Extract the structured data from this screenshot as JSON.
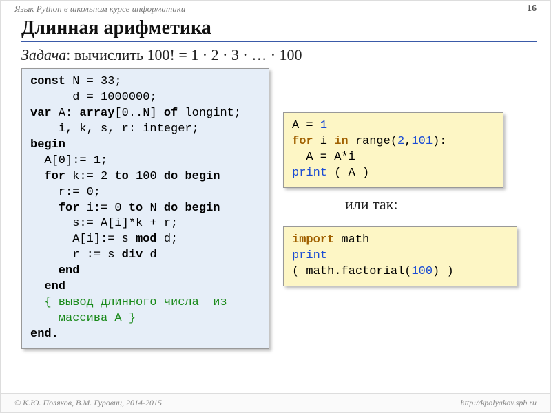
{
  "header": {
    "course": "Язык Python в школьном курсе информатики",
    "page": "16"
  },
  "title": "Длинная арифметика",
  "task": {
    "label": "Задача",
    "text": ": вычислить 100! = 1 · 2 · 3  · … · 100"
  },
  "pascal": {
    "l1a": "const",
    "l1b": " N = 33;",
    "l2": "      d = 1000000;",
    "l3a": "var",
    "l3b": " A: ",
    "l3c": "array",
    "l3d": "[0..N] ",
    "l3e": "of",
    "l3f": " longint;",
    "l4": "    i, k, s, r: integer;",
    "l5": "begin",
    "l6": "  A[0]:= 1;",
    "l7a": "  ",
    "l7b": "for",
    "l7c": " k:= 2 ",
    "l7d": "to",
    "l7e": " 100 ",
    "l7f": "do begin",
    "l8": "    r:= 0;",
    "l9a": "    ",
    "l9b": "for",
    "l9c": " i:= 0 ",
    "l9d": "to",
    "l9e": " N ",
    "l9f": "do begin",
    "l10": "      s:= A[i]*k + r;",
    "l11a": "      A[i]:= s ",
    "l11b": "mod",
    "l11c": " d;",
    "l12a": "      r := s ",
    "l12b": "div",
    "l12c": " d",
    "l13": "    end",
    "l14": "  end",
    "l15": "  { вывод длинного числа  из\n    массива A }",
    "l16": "end."
  },
  "or_label": "или так:",
  "py1": {
    "l1a": "A = ",
    "l1b": "1",
    "l2a": "for",
    "l2b": " i ",
    "l2c": "in",
    "l2d": " range(",
    "l2e": "2",
    "l2f": ",",
    "l2g": "101",
    "l2h": "):",
    "l3": "  A = A*i",
    "l4a": "print",
    "l4b": " ( A )"
  },
  "py2": {
    "l1a": "import",
    "l1b": " math",
    "l2": "print",
    "l3a": "( math.factorial(",
    "l3b": "100",
    "l3c": ") )"
  },
  "footer": {
    "left": "© К.Ю. Поляков, В.М. Гуровиц, 2014-2015",
    "right": "http://kpolyakov.spb.ru"
  }
}
